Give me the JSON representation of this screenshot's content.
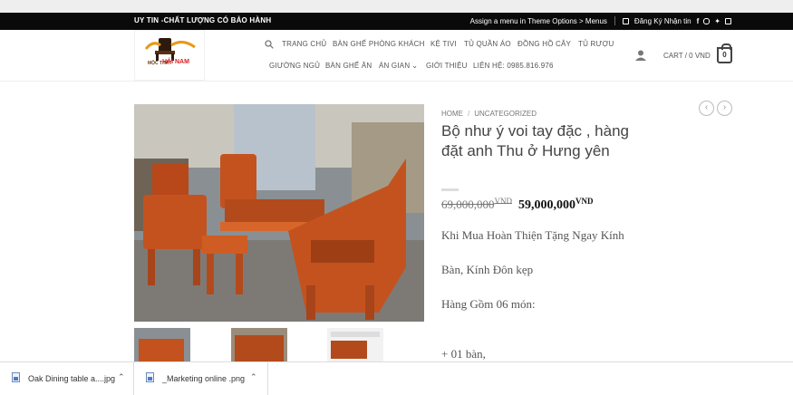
{
  "topbar": {
    "tagline": "UY TIN -CHẤT LƯỢNG CÓ BẢO HÀNH",
    "menu_notice": "Assign a menu in Theme Options > Menus",
    "newsletter": "Đăng Ký Nhận tin"
  },
  "logo": {
    "line1": "MỘC THẤT",
    "line2": "HẢI NAM"
  },
  "nav": {
    "items": [
      "TRANG CHỦ",
      "BÀN GHẾ PHÒNG KHÁCH",
      "KỆ TIVI",
      "TỦ QUẦN ÁO",
      "ĐỒNG HỒ CÂY",
      "TỦ RƯỢU",
      "GIƯỜNG NGỦ",
      "BÀN GHẾ ĂN",
      "ÁN GIAN",
      "GIỚI THIỆU",
      "LIÊN HỆ: 0985.816.976"
    ]
  },
  "cart": {
    "label": "CART / 0 VND",
    "count": "0"
  },
  "breadcrumb": {
    "home": "HOME",
    "category": "UNCATEGORIZED"
  },
  "product": {
    "title": "Bộ như ý voi tay đặc , hàng đặt anh Thu ở Hưng yên",
    "old_price": "69,000,000",
    "new_price": "59,000,000",
    "currency": "VND",
    "desc": [
      "Khi Mua Hoàn Thiện Tặng Ngay Kính",
      "Bàn, Kính Đôn kẹp",
      "Hàng Gồm 06 món:",
      "+ 01 bàn,"
    ]
  },
  "downloads": [
    {
      "name": "Oak Dining table a....jpg"
    },
    {
      "name": "_Marketing online .png"
    }
  ],
  "colors": {
    "topbar": "#0a0a0a",
    "wood": "#c4521e",
    "accent_red": "#d81e1e"
  }
}
